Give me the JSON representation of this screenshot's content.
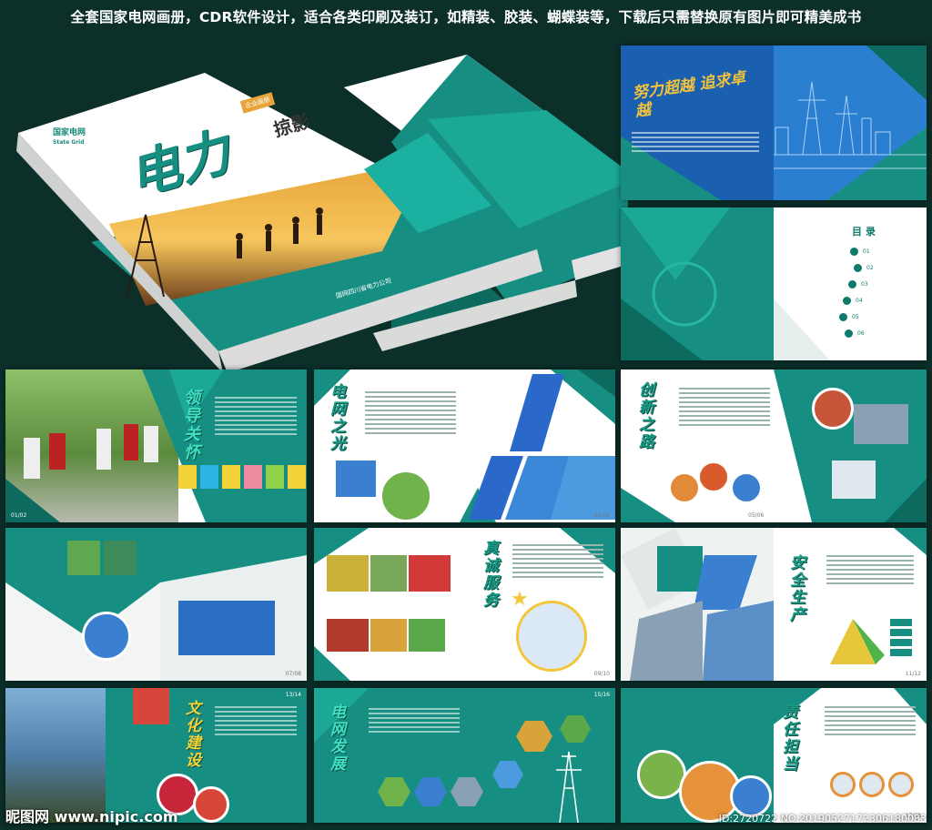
{
  "banner": {
    "text": "全套国家电网画册，CDR软件设计，适合各类印刷及装订，如精装、胶装、蝴蝶装等，下载后只需替换原有图片即可精美成书"
  },
  "cover": {
    "brand_cn": "国家电网",
    "brand_en": "State Grid",
    "title_main": "电力",
    "title_sub": "掠影",
    "badge": "企业画册",
    "company": "国网四川省电力公司"
  },
  "spreads": {
    "top_right_1": {
      "slogan": "努力超越 追求卓越"
    },
    "top_right_2": {
      "toc_title": "目录",
      "toc_numbers": [
        "01",
        "02",
        "03",
        "04",
        "05",
        "06"
      ]
    },
    "row1_a": {
      "calli": "领导关怀",
      "pagenum": "01/02"
    },
    "row1_b": {
      "calli": "电网之光",
      "pagenum": "03/04"
    },
    "row1_c": {
      "calli": "创新之路",
      "pagenum": "05/06"
    },
    "row2_a": {
      "pagenum": "07/08"
    },
    "row2_b": {
      "calli": "真诚服务",
      "pagenum": "09/10"
    },
    "row2_c": {
      "calli": "安全生产",
      "pagenum": "11/12"
    },
    "row3_a": {
      "calli": "文化建设",
      "pagenum": "13/14"
    },
    "row3_b": {
      "calli": "电网发展",
      "pagenum": "15/16"
    },
    "row3_c": {
      "calli": "责任担当",
      "pagenum": "17/18"
    }
  },
  "watermark": {
    "site": "昵图网 www.nipic.com",
    "id": "ID:2720722 NO:20190527172306180083"
  },
  "colors": {
    "teal": "#168f82",
    "dark_teal": "#0d6a5f",
    "background": "#0c2f2a"
  }
}
